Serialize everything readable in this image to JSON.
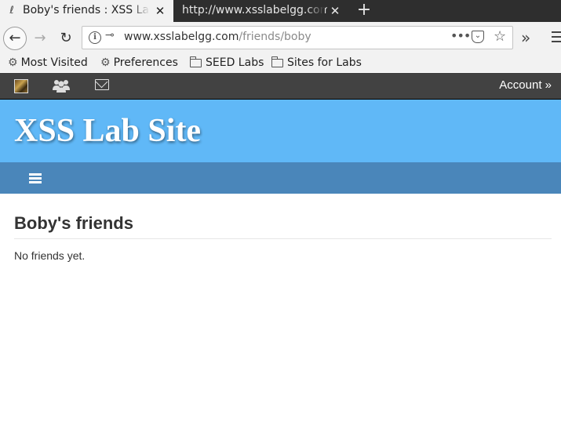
{
  "browser": {
    "tabs": [
      {
        "title": "Boby's friends : XSS Lab Site",
        "active": true,
        "close_label": "✕"
      },
      {
        "title": "http://www.xsslabelgg.com/",
        "active": false,
        "close_label": "✕"
      }
    ],
    "new_tab_label": "+",
    "url": {
      "host": "www.xsslabelgg.com",
      "path": "/friends/boby"
    },
    "bookmarks": [
      {
        "label": "Most Visited",
        "icon": "gear-icon"
      },
      {
        "label": "Preferences",
        "icon": "gear-icon"
      },
      {
        "label": "SEED Labs",
        "icon": "folder-icon"
      },
      {
        "label": "Sites for Labs",
        "icon": "folder-icon"
      }
    ]
  },
  "topbar": {
    "account_label": "Account",
    "account_arrow": "»"
  },
  "site": {
    "title": "XSS Lab Site"
  },
  "main": {
    "heading": "Boby's friends",
    "empty_message": "No friends yet."
  },
  "colors": {
    "topbar": "#424242",
    "header": "#60b8f7",
    "menubar": "#4a86ba",
    "text": "#333333"
  }
}
